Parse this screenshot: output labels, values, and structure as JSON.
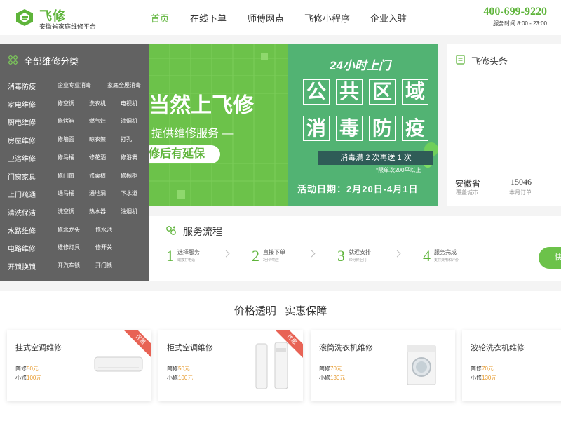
{
  "header": {
    "brand": "飞修",
    "brand_sub": "安徽省家庭维修平台",
    "nav": [
      "首页",
      "在线下单",
      "师傅网点",
      "飞修小程序",
      "企业入驻"
    ],
    "hotline": "400-699-9220",
    "hours": "服务时间 8:00 - 23:00"
  },
  "categories": {
    "title": "全部维修分类",
    "rows": [
      {
        "name": "消毒防疫",
        "subs": [
          "企业专业消毒",
          "家庭全屋消毒"
        ]
      },
      {
        "name": "家电维修",
        "subs": [
          "修空调",
          "洗衣机",
          "电视机"
        ]
      },
      {
        "name": "厨电维修",
        "subs": [
          "修烤箱",
          "燃气灶",
          "油烟机"
        ]
      },
      {
        "name": "房屋维修",
        "subs": [
          "修墙面",
          "晾衣架",
          "打孔"
        ]
      },
      {
        "name": "卫浴维修",
        "subs": [
          "修马桶",
          "修花洒",
          "修浴霸"
        ]
      },
      {
        "name": "门窗家具",
        "subs": [
          "修门窗",
          "修桌椅",
          "修橱柜"
        ]
      },
      {
        "name": "上门疏通",
        "subs": [
          "通马桶",
          "通地漏",
          "下水道"
        ]
      },
      {
        "name": "清洗保洁",
        "subs": [
          "洗空调",
          "热水器",
          "油烟机"
        ]
      },
      {
        "name": "水路维修",
        "subs": [
          "修水龙头",
          "修水池"
        ]
      },
      {
        "name": "电路维修",
        "subs": [
          "维修灯具",
          "修开关"
        ]
      },
      {
        "name": "开锁换锁",
        "subs": [
          "开汽车锁",
          "开门锁"
        ]
      }
    ]
  },
  "banner_left": {
    "headline": "当然上飞修",
    "line2": "提供维修服务 —",
    "pill": "修后有延保"
  },
  "banner_right": {
    "top": "24小时上门",
    "row1": [
      "公",
      "共",
      "区",
      "域"
    ],
    "row2": [
      "消",
      "毒",
      "防",
      "疫"
    ],
    "promo": "消毒满 2 次再送 1 次",
    "note": "*限单次200平以上",
    "date": "活动日期：2月20日-4月1日"
  },
  "headlines": {
    "title": "飞修头条",
    "stats": [
      {
        "value": "安徽省",
        "label": "覆盖城市"
      },
      {
        "value": "15046",
        "label": "本月订单"
      }
    ]
  },
  "process": {
    "title": "服务流程",
    "steps": [
      {
        "num": "1",
        "main": "选择服务",
        "sub": "或拨打电话"
      },
      {
        "num": "2",
        "main": "直接下单",
        "sub": "3分钟响应"
      },
      {
        "num": "3",
        "main": "就近安排",
        "sub": "30分钟上门"
      },
      {
        "num": "4",
        "main": "服务完成",
        "sub": "支付费用和评价"
      }
    ],
    "cta": "快"
  },
  "price": {
    "title": "价格透明   实惠保障",
    "ribbon": "优惠",
    "cards": [
      {
        "title": "挂式空调维修",
        "simple": "50元",
        "small": "100元",
        "ribbon": true
      },
      {
        "title": "柜式空调维修",
        "simple": "50元",
        "small": "100元",
        "ribbon": true
      },
      {
        "title": "滚筒洗衣机维修",
        "simple": "70元",
        "small": "130元",
        "ribbon": false
      },
      {
        "title": "波轮洗衣机维修",
        "simple": "70元",
        "small": "130元",
        "ribbon": false
      }
    ],
    "simple_label": "简修",
    "small_label": "小修"
  },
  "colors": {
    "brand": "#5eb43a",
    "sidebar": "#626262",
    "price": "#e69a2e",
    "ribbon": "#e86355"
  }
}
